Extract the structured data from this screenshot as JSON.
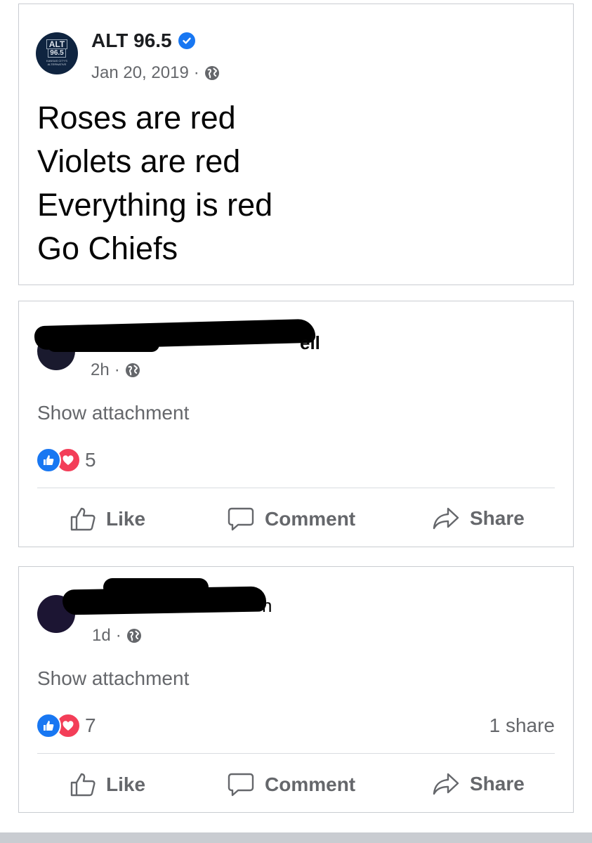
{
  "post": {
    "page_name": "ALT 96.5",
    "logo_text_top": "ALT",
    "logo_text_num": "96.5",
    "logo_tagline": "KANSAS CITY'S ALTERNATIVE",
    "date": "Jan 20, 2019",
    "separator": "·",
    "lines": [
      "Roses are red",
      "Violets are red",
      "Everything is red",
      "Go Chiefs"
    ],
    "verified_icon": "verified-badge-icon",
    "privacy_icon": "globe-icon"
  },
  "comments": [
    {
      "visible_name_fragment": "ell",
      "time": "2h",
      "attachment_label": "Show attachment",
      "reaction_count": "5",
      "share_count": ""
    },
    {
      "visible_name_fragment": "n",
      "time": "1d",
      "attachment_label": "Show attachment",
      "reaction_count": "7",
      "share_count": "1 share"
    }
  ],
  "actions": {
    "like": "Like",
    "comment": "Comment",
    "share": "Share"
  },
  "colors": {
    "accent": "#1877f2",
    "love": "#f33e58",
    "secondary_text": "#65676b",
    "border": "#c9ccd1"
  }
}
